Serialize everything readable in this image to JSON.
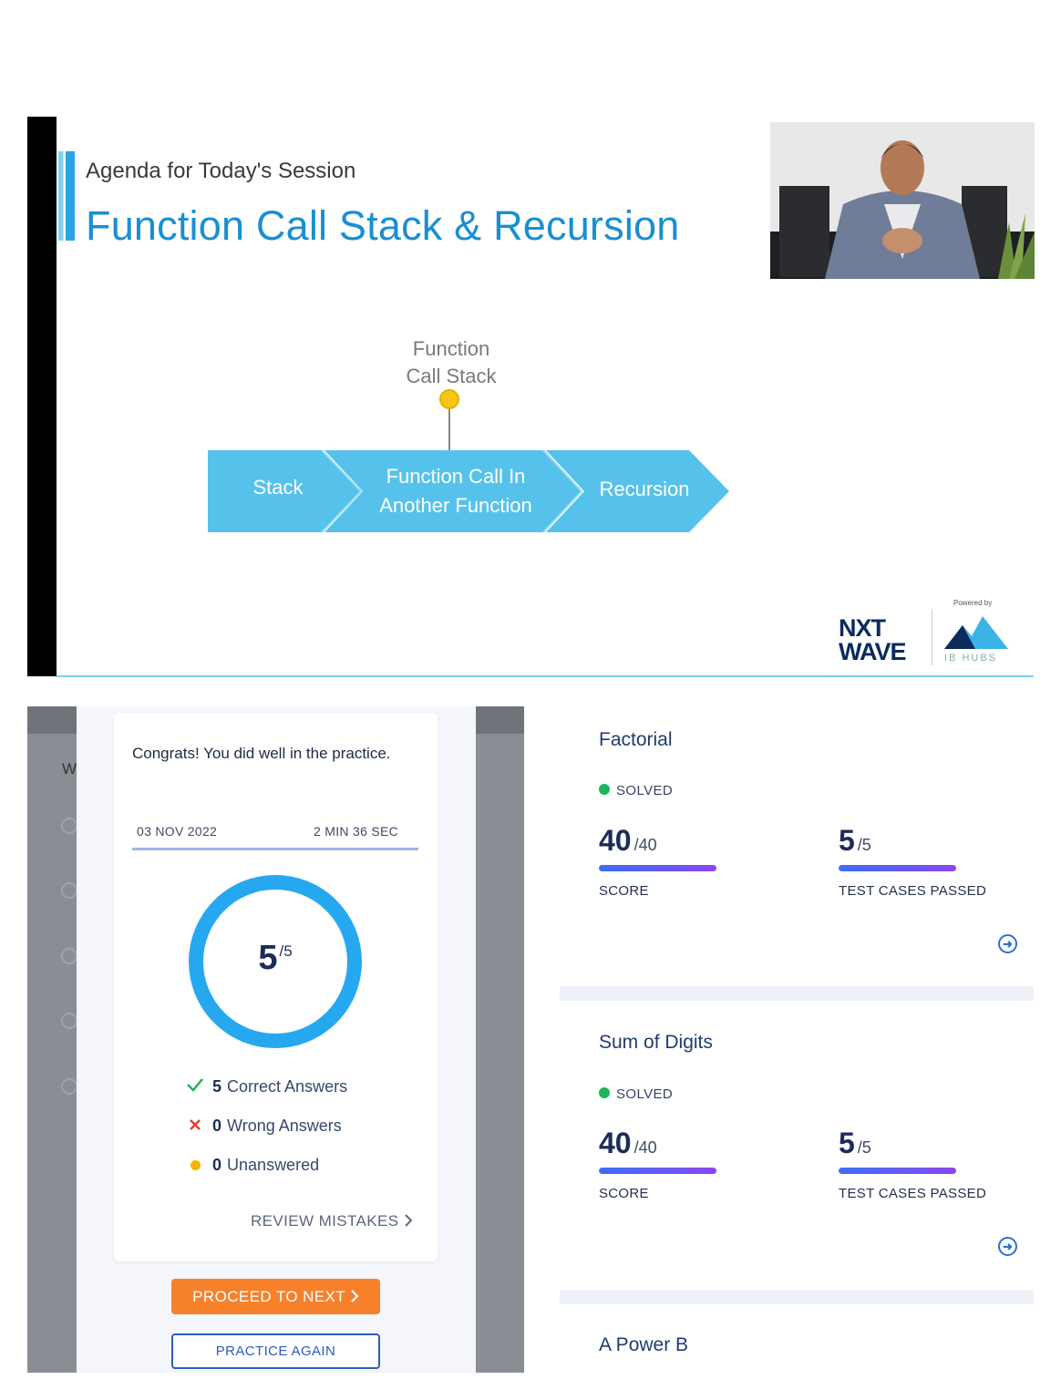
{
  "slide": {
    "agenda_label": "Agenda for Today's Session",
    "title": "Function Call Stack & Recursion",
    "callout_label": "Function\nCall Stack",
    "flow_steps": [
      "Stack",
      "Function Call In Another Function",
      "Recursion"
    ],
    "brand_logo": "NXT WAVE",
    "powered_by": "Powered by",
    "partner_logo": "IB HUBS"
  },
  "result_card": {
    "background_letter": "W",
    "message": "Congrats! You did well in the practice.",
    "date": "03 NOV 2022",
    "duration": "2 MIN 36 SEC",
    "score": "5",
    "score_total": "/5",
    "score_fraction": 1.0,
    "correct_count": "5",
    "correct_label": "Correct Answers",
    "wrong_count": "0",
    "wrong_label": "Wrong Answers",
    "unanswered_count": "0",
    "unanswered_label": "Unanswered",
    "review_label": "REVIEW MISTAKES",
    "proceed_label": "PROCEED TO NEXT",
    "practice_again_label": "PRACTICE AGAIN",
    "colors": {
      "ring": "#26a8f0",
      "proceed": "#f7812a",
      "correct": "#1bb55c",
      "wrong": "#e53935",
      "unanswered": "#f5b400"
    }
  },
  "problems": [
    {
      "title": "Factorial",
      "status": "SOLVED",
      "score": "40",
      "score_total": "/40",
      "score_label": "SCORE",
      "tests": "5",
      "tests_total": "/5",
      "tests_label": "TEST CASES PASSED",
      "score_fraction": 1.0,
      "tests_fraction": 1.0
    },
    {
      "title": "Sum of Digits",
      "status": "SOLVED",
      "score": "40",
      "score_total": "/40",
      "score_label": "SCORE",
      "tests": "5",
      "tests_total": "/5",
      "tests_label": "TEST CASES PASSED",
      "score_fraction": 1.0,
      "tests_fraction": 1.0
    },
    {
      "title": "A Power B"
    }
  ]
}
